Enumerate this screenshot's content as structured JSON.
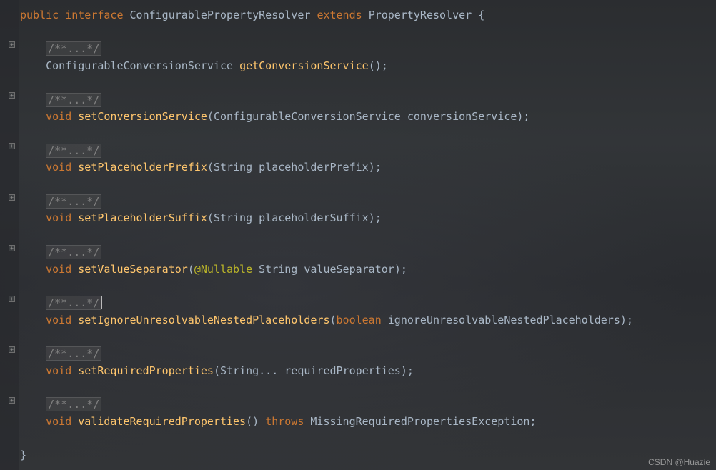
{
  "code": {
    "decl": {
      "public": "public",
      "interface": "interface",
      "name": "ConfigurablePropertyResolver",
      "extends": "extends",
      "parent": "PropertyResolver",
      "openBrace": "{"
    },
    "foldedComment": "/**...*/",
    "methods": [
      {
        "returnType": "ConfigurableConversionService",
        "name": "getConversionService",
        "params": "",
        "end": "();"
      },
      {
        "returnKw": "void",
        "name": "setConversionService",
        "paramsPrefix": "(",
        "paramType": "ConfigurableConversionService",
        "paramName": "conversionService",
        "end": ");"
      },
      {
        "returnKw": "void",
        "name": "setPlaceholderPrefix",
        "paramsPrefix": "(",
        "paramType": "String",
        "paramName": "placeholderPrefix",
        "end": ");"
      },
      {
        "returnKw": "void",
        "name": "setPlaceholderSuffix",
        "paramsPrefix": "(",
        "paramType": "String",
        "paramName": "placeholderSuffix",
        "end": ");"
      },
      {
        "returnKw": "void",
        "name": "setValueSeparator",
        "paramsPrefix": "(",
        "annotation": "@Nullable",
        "paramType": "String",
        "paramName": "valueSeparator",
        "end": ");"
      },
      {
        "returnKw": "void",
        "name": "setIgnoreUnresolvableNestedPlaceholders",
        "paramsPrefix": "(",
        "paramTypeKw": "boolean",
        "paramName": "ignoreUnresolvableNestedPlaceholders",
        "end": ");"
      },
      {
        "returnKw": "void",
        "name": "setRequiredProperties",
        "paramsPrefix": "(",
        "paramType": "String...",
        "paramName": "requiredProperties",
        "end": ");"
      },
      {
        "returnKw": "void",
        "name": "validateRequiredProperties",
        "paramsPrefix": "()",
        "throwsKw": "throws",
        "exceptionType": "MissingRequiredPropertiesException",
        "end": ";"
      }
    ],
    "closeBrace": "}"
  },
  "watermark": "CSDN @Huazie",
  "foldPositions": [
    58,
    129,
    200,
    272,
    343,
    414,
    485,
    556
  ]
}
